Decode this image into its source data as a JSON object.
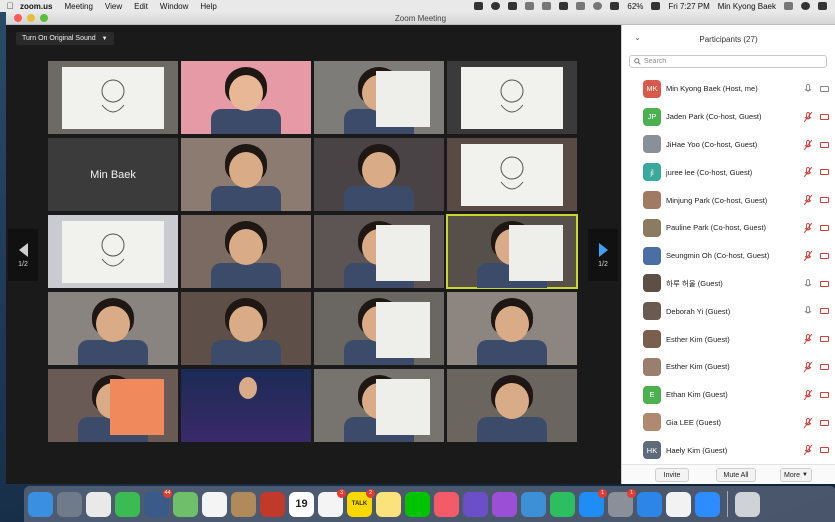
{
  "menubar": {
    "app_name": "zoom.us",
    "menus": [
      "Meeting",
      "View",
      "Edit",
      "Window",
      "Help"
    ],
    "battery": "62%",
    "clock": "Fri 7:27 PM",
    "user": "Min Kyong Baek"
  },
  "window": {
    "title": "Zoom Meeting"
  },
  "meeting": {
    "sound_button": "Turn On Original Sound",
    "page_left": "1/2",
    "page_right": "1/2",
    "tiles": [
      {
        "kind": "drawing"
      },
      {
        "kind": "face-pink"
      },
      {
        "kind": "paper-hand"
      },
      {
        "kind": "drawing-bear"
      },
      {
        "kind": "name",
        "label": "Min Baek"
      },
      {
        "kind": "face"
      },
      {
        "kind": "kid-desk"
      },
      {
        "kind": "drawing-bear"
      },
      {
        "kind": "drawing"
      },
      {
        "kind": "face"
      },
      {
        "kind": "kid-paper"
      },
      {
        "kind": "paper-hand",
        "active": true
      },
      {
        "kind": "face"
      },
      {
        "kind": "kid-desk"
      },
      {
        "kind": "paper-hand"
      },
      {
        "kind": "face"
      },
      {
        "kind": "face-orange"
      },
      {
        "kind": "screen"
      },
      {
        "kind": "paper-hand"
      },
      {
        "kind": "face"
      }
    ]
  },
  "participants": {
    "title": "Participants (27)",
    "search_placeholder": "Search",
    "list": [
      {
        "name": "Min Kyong Baek (Host, me)",
        "initials": "MK",
        "color": "#d95a4a",
        "mic_muted": false,
        "video_on": true
      },
      {
        "name": "Jaden Park (Co-host, Guest)",
        "initials": "JP",
        "color": "#4caf50",
        "mic_muted": true,
        "video_on": false
      },
      {
        "name": "JiHae Yoo (Co-host, Guest)",
        "initials": "",
        "color": "#8a8f99",
        "mic_muted": true,
        "video_on": false
      },
      {
        "name": "juree lee (Co-host, Guest)",
        "initials": "jl",
        "color": "#3aa89a",
        "mic_muted": true,
        "video_on": false
      },
      {
        "name": "Minjung Park (Co-host, Guest)",
        "initials": "",
        "color": "#a07a62",
        "mic_muted": true,
        "video_on": false
      },
      {
        "name": "Pauline Park (Co-host, Guest)",
        "initials": "",
        "color": "#8b7b60",
        "mic_muted": true,
        "video_on": false
      },
      {
        "name": "Seungmin Oh (Co-host, Guest)",
        "initials": "",
        "color": "#4a6fa5",
        "mic_muted": true,
        "video_on": false
      },
      {
        "name": "하루 허울 (Guest)",
        "initials": "",
        "color": "#5d4f46",
        "mic_muted": false,
        "video_on": false
      },
      {
        "name": "Deborah Yi (Guest)",
        "initials": "",
        "color": "#6b5a4f",
        "mic_muted": false,
        "video_on": false
      },
      {
        "name": "Esther Kim (Guest)",
        "initials": "",
        "color": "#7a5e4e",
        "mic_muted": true,
        "video_on": false
      },
      {
        "name": "Esther Kim (Guest)",
        "initials": "",
        "color": "#9b7f6e",
        "mic_muted": true,
        "video_on": false
      },
      {
        "name": "Ethan Kim (Guest)",
        "initials": "E",
        "color": "#4caf50",
        "mic_muted": true,
        "video_on": false
      },
      {
        "name": "Gia LEE (Guest)",
        "initials": "",
        "color": "#b08a70",
        "mic_muted": true,
        "video_on": false
      },
      {
        "name": "Haely Kim (Guest)",
        "initials": "HK",
        "color": "#5d6b7a",
        "mic_muted": true,
        "video_on": false
      }
    ],
    "invite_label": "Invite",
    "mute_all_label": "Mute All",
    "more_label": "More"
  },
  "dock": {
    "apps": [
      {
        "name": "finder",
        "color": "#3b8fe0"
      },
      {
        "name": "launchpad",
        "color": "#6f7a8a"
      },
      {
        "name": "chrome",
        "color": "#e9e9e9"
      },
      {
        "name": "facetime",
        "color": "#3cba54"
      },
      {
        "name": "photo-booth",
        "color": "#3a5a8a",
        "badge": "44"
      },
      {
        "name": "maps",
        "color": "#6fbf6a"
      },
      {
        "name": "photos",
        "color": "#f4f4f4"
      },
      {
        "name": "notes-brown",
        "color": "#b08a5a"
      },
      {
        "name": "photo-booth-red",
        "color": "#c0392b"
      },
      {
        "name": "calendar",
        "color": "#ffffff",
        "label": "19"
      },
      {
        "name": "reminders",
        "color": "#f4f4f4",
        "badge": "3"
      },
      {
        "name": "kakaotalk",
        "color": "#f7d900",
        "label": "TALK",
        "badge": "2"
      },
      {
        "name": "stickies",
        "color": "#fbe27a"
      },
      {
        "name": "line",
        "color": "#00c300"
      },
      {
        "name": "music",
        "color": "#f45b69"
      },
      {
        "name": "imovie",
        "color": "#6a4fc8"
      },
      {
        "name": "podcasts",
        "color": "#9b4fd6"
      },
      {
        "name": "preview",
        "color": "#3d8fd6"
      },
      {
        "name": "evernote",
        "color": "#2dbe60"
      },
      {
        "name": "app-store",
        "color": "#1e8df5",
        "badge": "1"
      },
      {
        "name": "system-preferences",
        "color": "#8a8f99",
        "badge": "1"
      },
      {
        "name": "safari",
        "color": "#2b86e8"
      },
      {
        "name": "textedit",
        "color": "#f2f2f2"
      },
      {
        "name": "zoom",
        "color": "#2d8cff"
      },
      {
        "name": "trash",
        "color": "#cfd3d8"
      }
    ]
  }
}
